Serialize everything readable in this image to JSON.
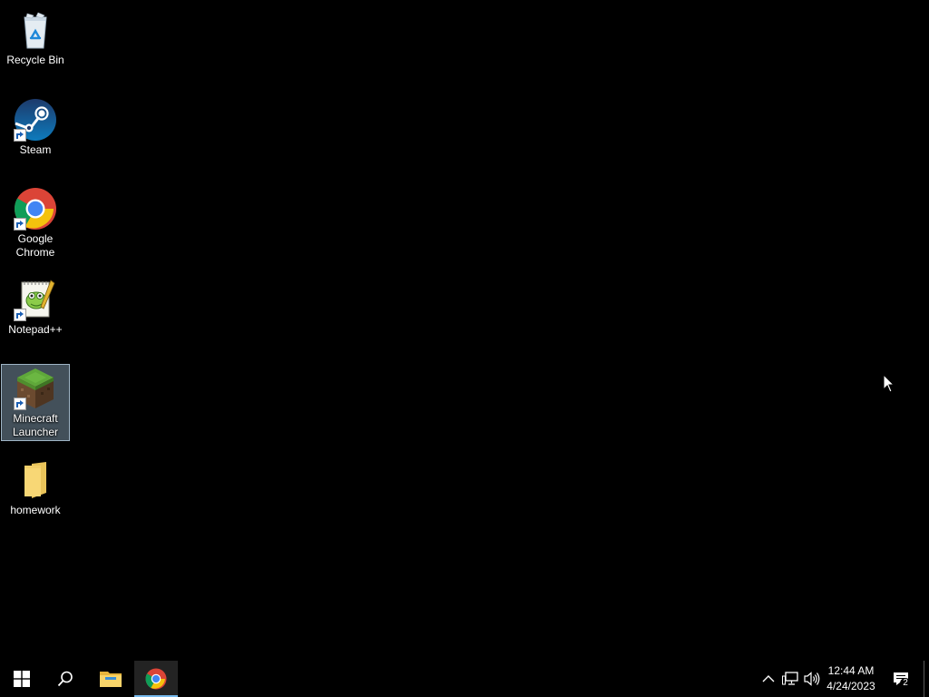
{
  "desktop": {
    "icons": [
      {
        "label": "Recycle Bin",
        "icon": "recycle-bin-icon",
        "selected": false
      },
      {
        "label": "Steam",
        "icon": "steam-icon",
        "selected": false
      },
      {
        "label": "Google Chrome",
        "icon": "chrome-icon",
        "selected": false
      },
      {
        "label": "Notepad++",
        "icon": "notepad-plus-plus-icon",
        "selected": false
      },
      {
        "label": "Minecraft Launcher",
        "icon": "minecraft-icon",
        "selected": true
      },
      {
        "label": "homework",
        "icon": "folder-icon",
        "selected": false
      }
    ]
  },
  "taskbar": {
    "clock": {
      "time": "12:44 AM",
      "date": "4/24/2023"
    },
    "notification_count": "2",
    "pinned": [
      "file-explorer-icon",
      "chrome-icon"
    ],
    "tray_icons": [
      "chevron-up-icon",
      "network-icon",
      "volume-icon",
      "action-center-icon"
    ]
  },
  "colors": {
    "desktop_background": "#000000",
    "taskbar_background": "#000000",
    "active_app_highlight": "#232323",
    "active_underline": "#76b9ed",
    "selection_fill": "#a0bed7"
  }
}
